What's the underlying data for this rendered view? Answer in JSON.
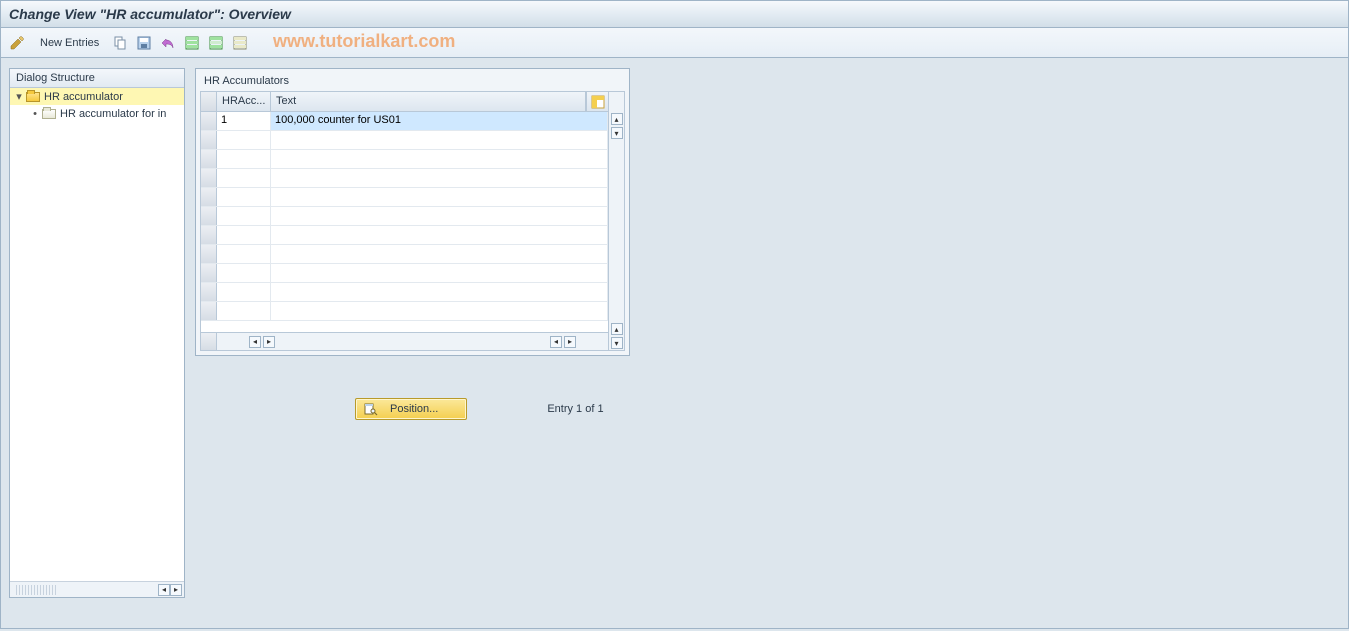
{
  "title": "Change View \"HR accumulator\": Overview",
  "toolbar": {
    "new_entries_label": "New Entries"
  },
  "watermark": "www.tutorialkart.com",
  "dialog_structure": {
    "header": "Dialog Structure",
    "items": [
      {
        "label": "HR accumulator",
        "selected": true,
        "open": true,
        "level": 0
      },
      {
        "label": "HR accumulator for in",
        "selected": false,
        "open": false,
        "level": 1
      }
    ]
  },
  "table": {
    "title": "HR Accumulators",
    "columns": {
      "c1": "HRAcc...",
      "c2": "Text"
    },
    "rows": [
      {
        "c1": "1",
        "c2": "100,000 counter for US01"
      }
    ]
  },
  "position_button": "Position...",
  "entry_text": "Entry 1 of 1"
}
